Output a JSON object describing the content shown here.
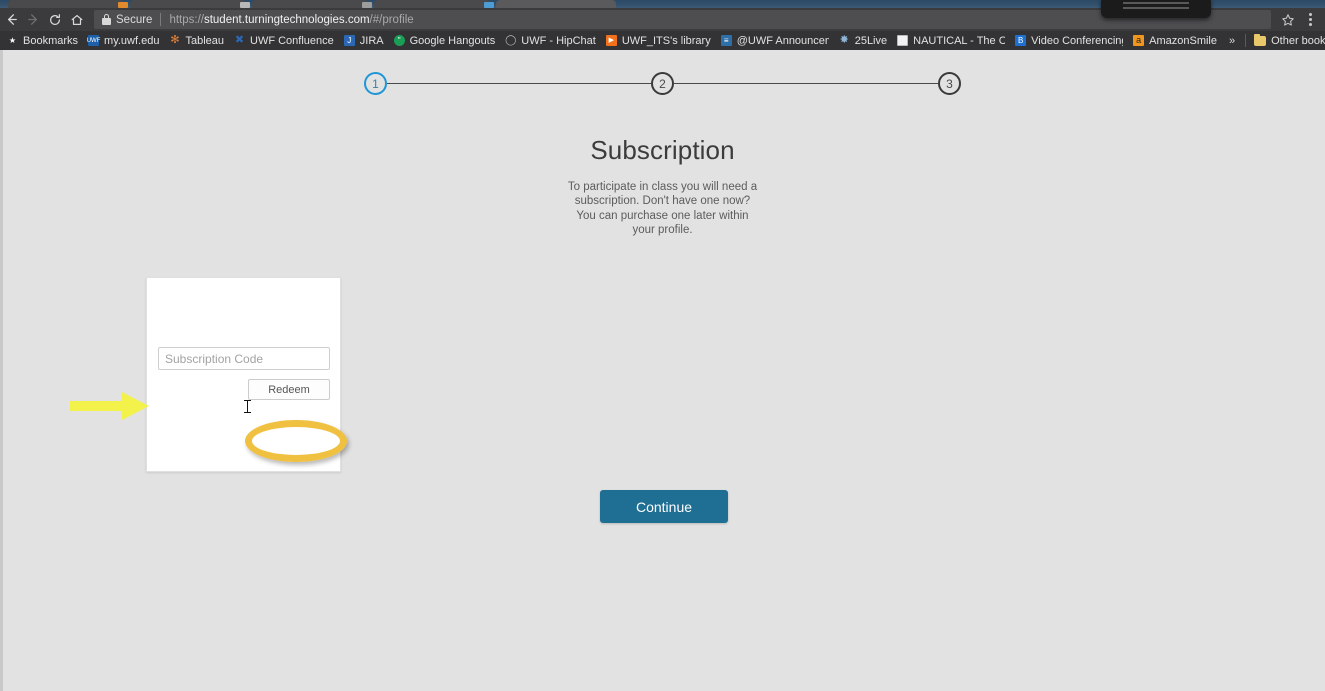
{
  "browser": {
    "nav": {
      "back_icon": "arrow-left-icon",
      "forward_icon": "arrow-right-icon",
      "reload_icon": "reload-icon",
      "home_icon": "home-icon",
      "star_icon": "star-icon",
      "menu_icon": "kebab-menu-icon"
    },
    "omnibox": {
      "security_label": "Secure",
      "lock_icon": "lock-icon",
      "url_scheme": "https://",
      "url_host": "student.turningtechnologies.com",
      "url_path": "/#/profile",
      "url_full": "https://student.turningtechnologies.com/#/profile"
    },
    "bookmarks": [
      {
        "label": "Bookmarks",
        "icon": "star-icon",
        "fav_color": "none",
        "fav_text": "★"
      },
      {
        "label": "my.uwf.edu",
        "icon": "uwf-icon",
        "fav_color": "#1d5fa8",
        "fav_text": "UWF"
      },
      {
        "label": "Tableau",
        "icon": "tableau-icon",
        "fav_color": "none",
        "fav_text": "✻"
      },
      {
        "label": "UWF Confluence",
        "icon": "confluence-icon",
        "fav_color": "none",
        "fav_text": "✖"
      },
      {
        "label": "JIRA",
        "icon": "jira-icon",
        "fav_color": "#2a67b5",
        "fav_text": "J"
      },
      {
        "label": "Google Hangouts",
        "icon": "hangouts-icon",
        "fav_color": "#1a9e56",
        "fav_text": "\""
      },
      {
        "label": "UWF - HipChat",
        "icon": "hipchat-icon",
        "fav_color": "none",
        "fav_text": "◯"
      },
      {
        "label": "UWF_ITS's library",
        "icon": "play-icon",
        "fav_color": "#f2711c",
        "fav_text": "▶"
      },
      {
        "label": "@UWF Announceme",
        "icon": "announcements-icon",
        "fav_color": "#2f6fa8",
        "fav_text": "≡"
      },
      {
        "label": "25Live",
        "icon": "25live-icon",
        "fav_color": "none",
        "fav_text": "✸"
      },
      {
        "label": "NAUTICAL - The Com",
        "icon": "document-icon",
        "fav_color": "doc",
        "fav_text": ""
      },
      {
        "label": "Video Conferencing",
        "icon": "video-conf-icon",
        "fav_color": "#1d6fd0",
        "fav_text": "B"
      },
      {
        "label": "AmazonSmile",
        "icon": "amazon-icon",
        "fav_color": "#f0961e",
        "fav_text": "a"
      }
    ],
    "overflow_chevron": "»",
    "other_bookmarks": {
      "label": "Other bookmarks",
      "icon": "folder-icon"
    }
  },
  "page": {
    "stepper": {
      "steps": [
        {
          "number": "1",
          "state": "active"
        },
        {
          "number": "2",
          "state": "inactive"
        },
        {
          "number": "3",
          "state": "inactive"
        }
      ],
      "active_color": "#2196d6",
      "inactive_color": "#3a3a3a"
    },
    "title": "Subscription",
    "description": "To participate in class you will need a subscription. Don't have one now? You can purchase one later within your profile.",
    "card": {
      "code_input_placeholder": "Subscription Code",
      "code_input_value": "",
      "redeem_label": "Redeem"
    },
    "continue_label": "Continue",
    "accent_color": "#1f6e94"
  },
  "annotations": {
    "arrow": {
      "name": "yellow-arrow-annotation",
      "color": "#f2f24a",
      "points_to": "Subscription Code"
    },
    "ellipse": {
      "name": "yellow-ellipse-annotation",
      "color": "#f0c040",
      "highlights": "Redeem"
    },
    "cursor": {
      "name": "text-caret-cursor",
      "color": "#111111"
    }
  }
}
